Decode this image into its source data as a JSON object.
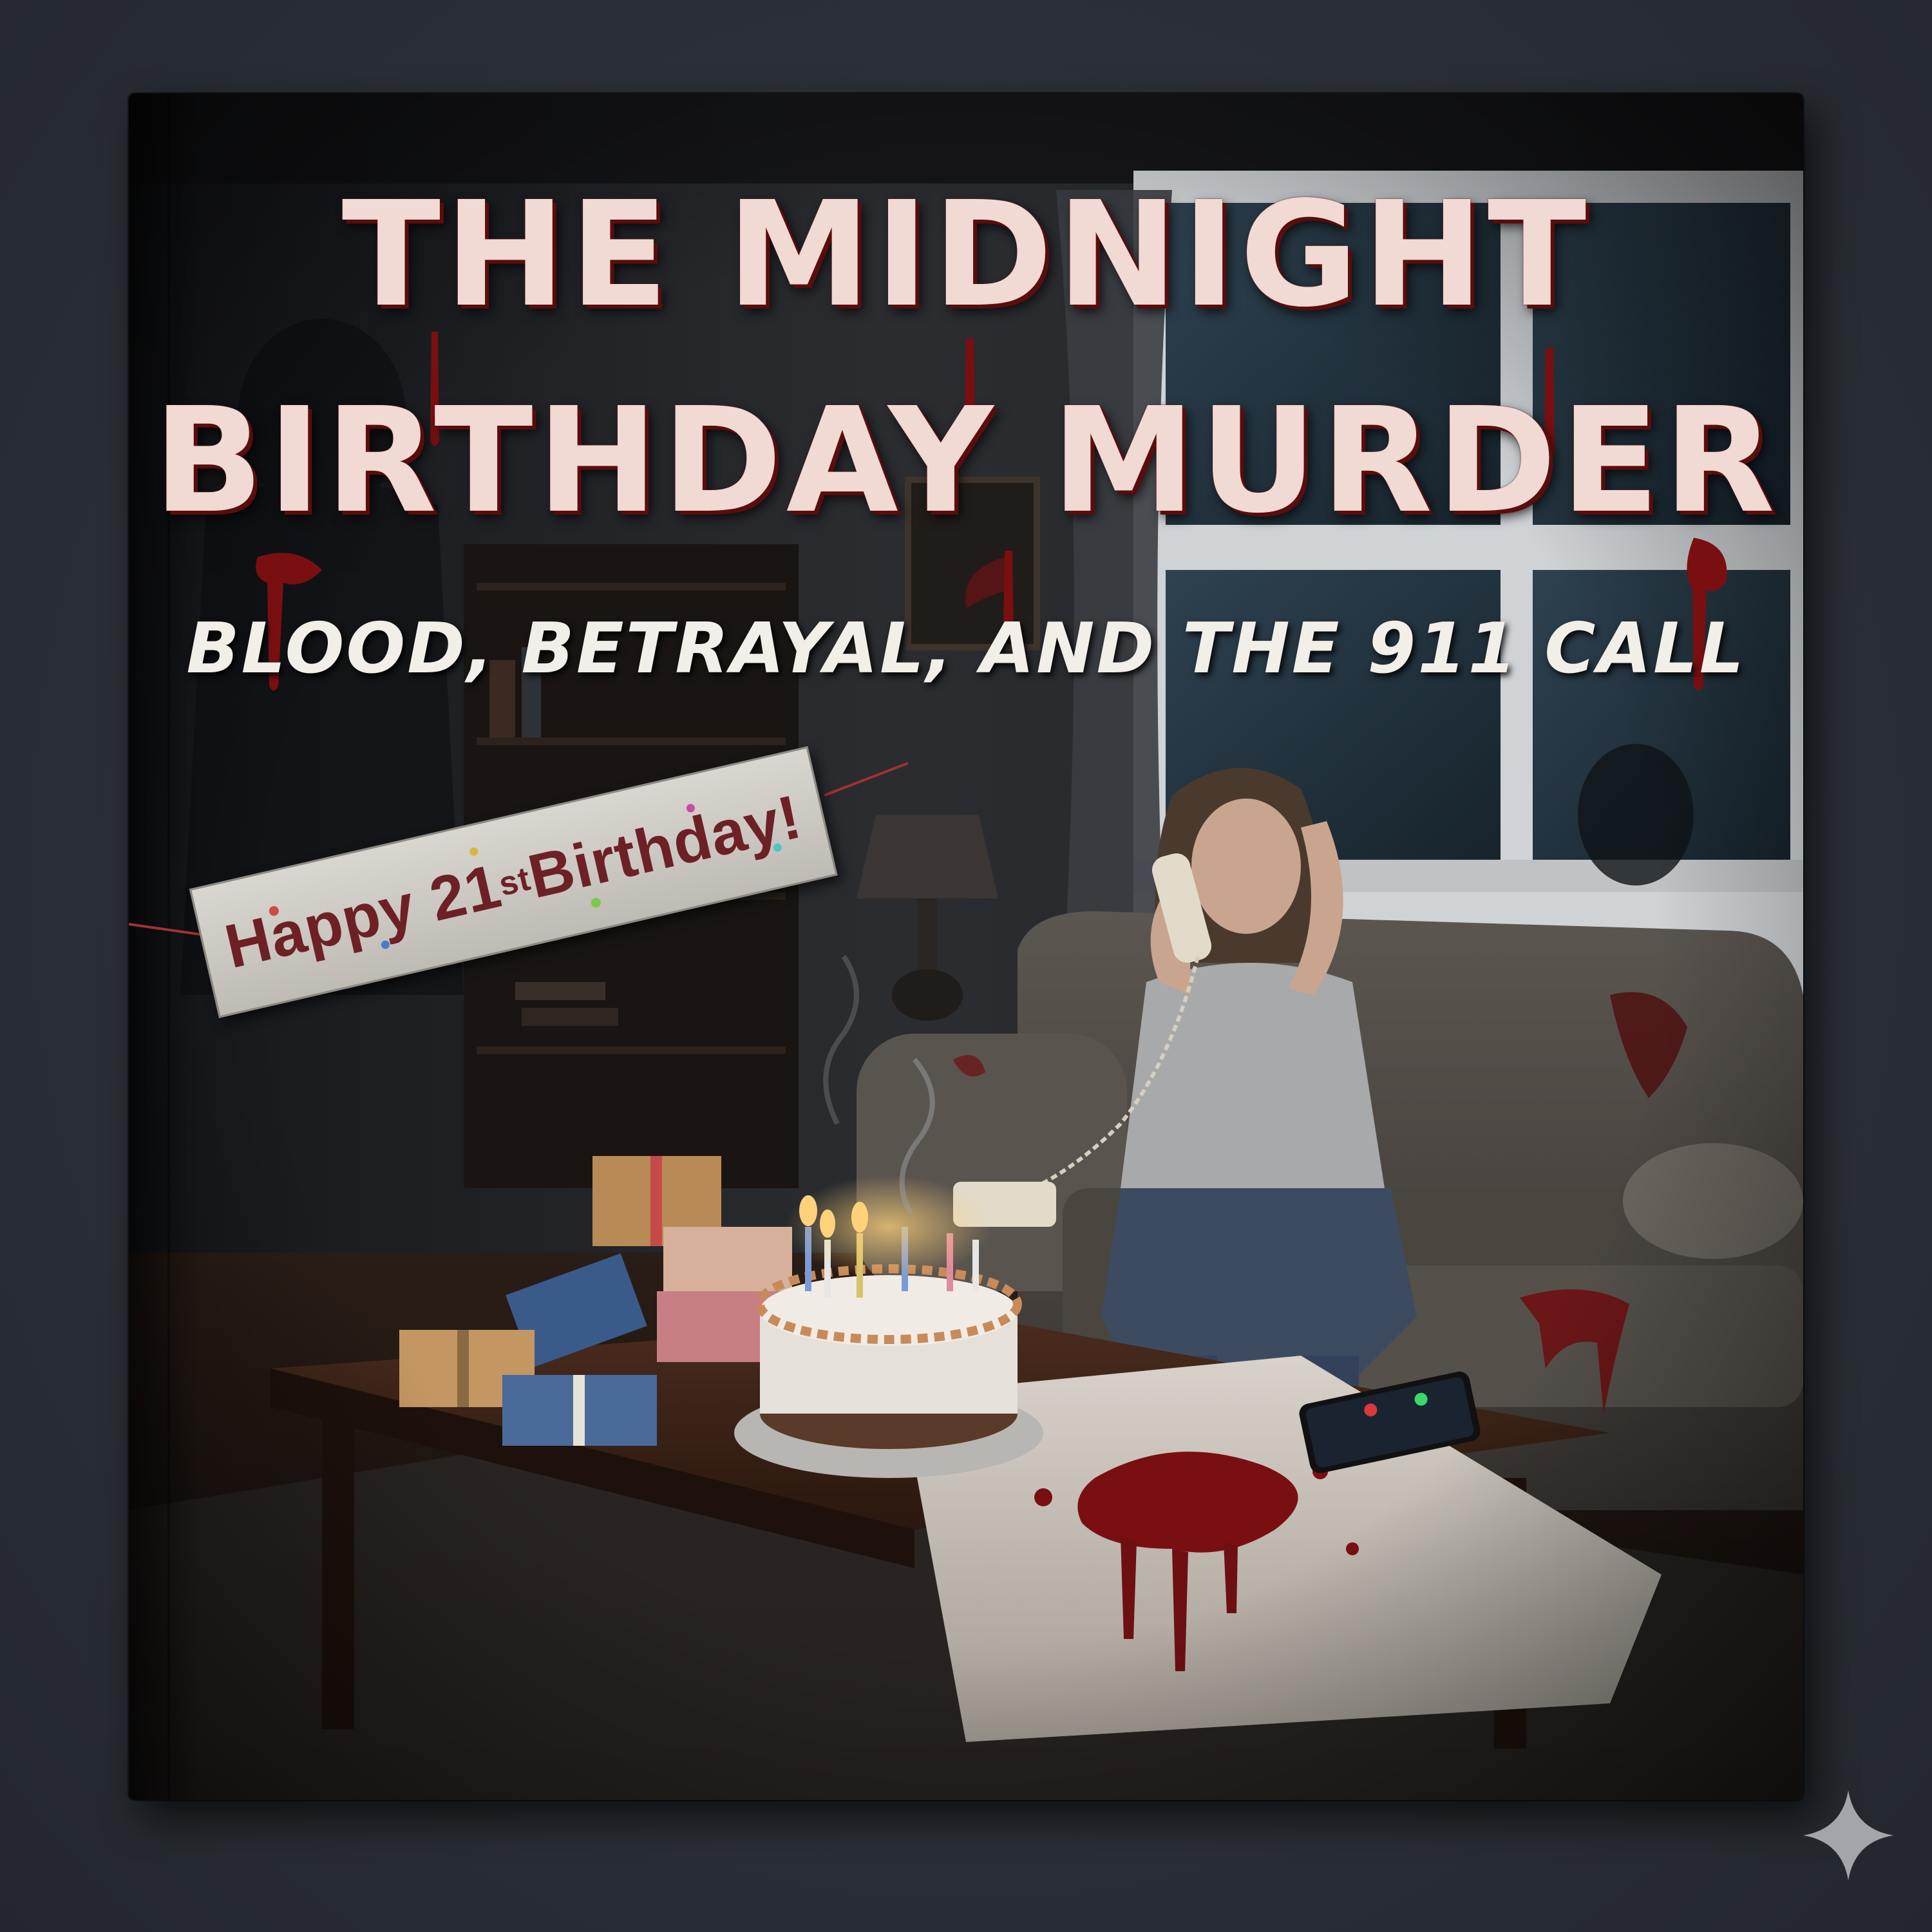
{
  "cover": {
    "title_line_1": "THE MIDNIGHT",
    "title_line_2": "BIRTHDAY MURDER",
    "subtitle": "BLOOD, BETRAYAL, AND THE 911 CALL"
  },
  "banner": {
    "text_before": "Happy 21",
    "superscript": "st",
    "text_after": " Birthday!"
  },
  "colors": {
    "background": "#2a2f36",
    "title_text": "#f1d9d4",
    "blood": "#7a0f12",
    "banner_text": "#6e2027"
  },
  "icons": {
    "corner_mark": "sparkle-icon"
  }
}
